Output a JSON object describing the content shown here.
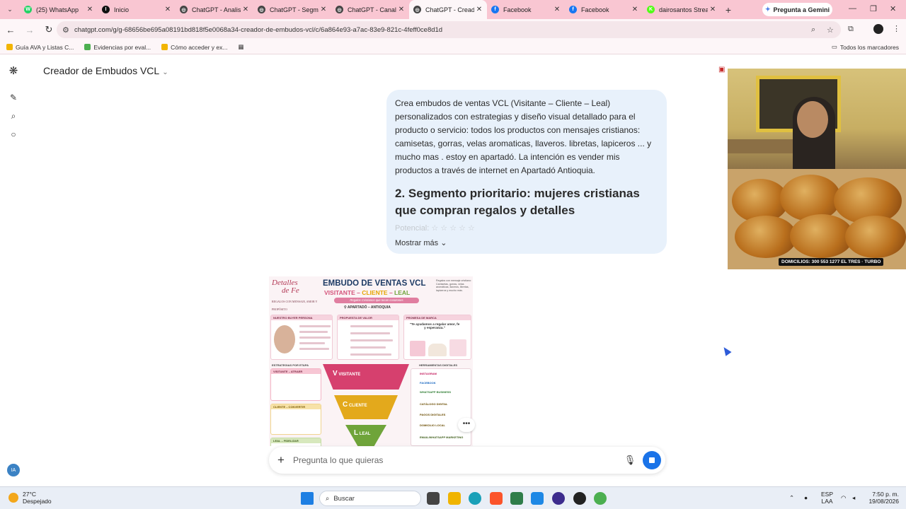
{
  "browser": {
    "tabs": [
      {
        "label": "(25) WhatsApp",
        "color": "#25d366",
        "glyph": "W"
      },
      {
        "label": "Inicio",
        "color": "#111111",
        "glyph": "I"
      },
      {
        "label": "ChatGPT - Analisti",
        "color": "#444444",
        "glyph": "◎"
      },
      {
        "label": "ChatGPT - Segme",
        "color": "#444444",
        "glyph": "◎"
      },
      {
        "label": "ChatGPT - Canal V",
        "color": "#444444",
        "glyph": "◎"
      },
      {
        "label": "ChatGPT - Creado",
        "color": "#444444",
        "glyph": "◎"
      },
      {
        "label": "Facebook",
        "color": "#1877f2",
        "glyph": "f"
      },
      {
        "label": "Facebook",
        "color": "#1877f2",
        "glyph": "f"
      },
      {
        "label": "dairosantos Strea",
        "color": "#53fc18",
        "glyph": "K"
      }
    ],
    "gemini_label": "Pregunta a Gemini",
    "url": "chatgpt.com/g/g-68656be695a08191bd818f5e0068a34-creador-de-embudos-vcl/c/6a864e93-a7ac-83e9-821c-4feff0ce8d1d",
    "bookmarks": [
      "Guía AVA y Listas C...",
      "Evidencias por eval...",
      "Cómo acceder y ex..."
    ],
    "bookmarks_all": "Todos los marcadores"
  },
  "chat": {
    "gpt_title": "Creador de Embudos VCL",
    "user_message": "Crea embudos de ventas VCL (Visitante – Cliente – Leal) personalizados con estrategias y diseño visual detallado para el producto o servicio: todos los productos con mensajes cristianos: camisetas, gorras, velas aromaticas, llaveros. libretas, lapiceros ... y mucho mas . estoy en apartadó. La intención es vender mis productos a través de internet en Apartadó Antioquia.",
    "heading": "2. Segmento prioritario: mujeres cristianas que compran regalos y detalles",
    "faded_line": "Potencial: ☆ ☆ ☆ ☆ ☆",
    "show_more": "Mostrar más",
    "composer_placeholder": "Pregunta lo que quieras",
    "avatar_initials": "IA"
  },
  "infographic": {
    "logo_line1": "Detalles",
    "logo_line2": "de Fe",
    "logo_tagline": "REGALOS CON MENSAJE, AMOR Y PROPÓSITO",
    "title": "EMBUDO DE VENTAS VCL",
    "subtitle_a": "VISITANTE",
    "subtitle_b": "CLIENTE",
    "subtitle_c": "LEAL",
    "ribbon": "Regalos Cristianos que tocan corazones",
    "location": "APARTADÓ – ANTIOQUIA",
    "side_text": "Regalos con mensaje cristiano: Camisetas, gorras, velas aromáticas, llaveros, libretas, lapiceros y mucho más.",
    "card_buyer": "NUESTRO BUYER PERSONA",
    "card_value": "PROPUESTA DE VALOR",
    "card_brand": "PROMESA DE MARCA",
    "brand_quote": "\"Te ayudamos a regalar amor, fe y esperanza.\"",
    "sec_strategies": "ESTRATEGIAS POR ETAPA",
    "sec_tools": "HERRAMIENTAS DIGITALES",
    "stage_v": "V",
    "stage_v_label": "VISITANTE",
    "stage_c": "C",
    "stage_c_label": "CLIENTE",
    "stage_l": "L",
    "stage_l_label": "LEAL",
    "left_v": "VISITANTE – ATRAER",
    "left_c": "CLIENTE – CONVERTIR",
    "left_l": "LEAL – FIDELIZAR",
    "tool_1": "INSTAGRAM",
    "tool_2": "FACEBOOK",
    "tool_3": "WHATSAPP BUSINESS",
    "tool_4": "CATÁLOGO DIGITAL",
    "tool_5": "PAGOS DIGITALES",
    "tool_6": "DOMICILIO LOCAL",
    "tool_7": "EMAIL/WHATSAPP MARKETING"
  },
  "webcam": {
    "caption": "DOMICILIOS: 300 553 1277 EL TRES · TURBO"
  },
  "taskbar": {
    "temp": "27°C",
    "weather": "Despejado",
    "search": "Buscar",
    "lang_top": "ESP",
    "lang_bottom": "LAA",
    "time": "7:50 p. m.",
    "date": "19/08/2026"
  }
}
